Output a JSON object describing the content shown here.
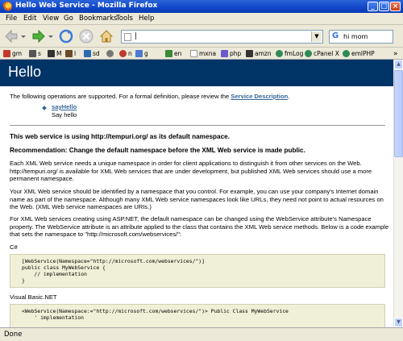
{
  "window": {
    "title": "Hello Web Service - Mozilla Firefox",
    "buttons": {
      "minimize": "_",
      "maximize": "□",
      "close": "×"
    }
  },
  "menu": [
    "File",
    "Edit",
    "View",
    "Go",
    "Bookmarks",
    "Tools",
    "Help"
  ],
  "address_bar": {
    "value": "|"
  },
  "search_bar": {
    "value": "hi mom"
  },
  "bookmarks": [
    {
      "label": "gm",
      "color": "#c0392b"
    },
    {
      "label": "s",
      "color": "#555555"
    },
    {
      "label": "M",
      "color": "#333333"
    },
    {
      "label": "l",
      "color": "#6b4a2b"
    },
    {
      "label": "sd",
      "color": "#2b6cb0"
    },
    {
      "label": "",
      "color": "#777777"
    },
    {
      "label": "n",
      "color": "#c0392b"
    },
    {
      "label": "g",
      "color": "#4a7bd0"
    },
    {
      "label": "en",
      "color": "#3a8a3a"
    },
    {
      "label": "mxna",
      "color": "#ffffff"
    },
    {
      "label": "php",
      "color": "#6a5acd"
    },
    {
      "label": "amzn",
      "color": "#333333"
    },
    {
      "label": "fmLog",
      "color": "#2e8b57"
    },
    {
      "label": "cPanel X",
      "color": "#2e8b57"
    },
    {
      "label": "emlPHP",
      "color": "#2e8b57"
    }
  ],
  "page": {
    "heading": "Hello",
    "intro": "The following operations are supported. For a formal definition, please review the",
    "service_description_link": "Service Description",
    "intro_end": ".",
    "operation_link": "sayHello",
    "operation_desc": "Say hello",
    "namespace_notice": "This web service is using http://tempuri.org/ as its default namespace.",
    "recommendation": "Recommendation: Change the default namespace before the XML Web service is made public.",
    "para1": "Each XML Web service needs a unique namespace in order for client applications to distinguish it from other services on the Web. http://tempuri.org/ is available for XML Web services that are under development, but published XML Web services should use a more permanent namespace.",
    "para2": "Your XML Web service should be identified by a namespace that you control. For example, you can use your company's Internet domain name as part of the namespace. Although many XML Web service namespaces look like URLs, they need not point to actual resources on the Web. (XML Web service namespaces are URIs.)",
    "para3": "For XML Web services creating using ASP.NET, the default namespace can be changed using the WebService attribute's Namespace property. The WebService attribute is an attribute applied to the class that contains the XML Web service methods. Below is a code example that sets the namespace to \"http://microsoft.com/webservices/\":",
    "csharp_label": "C#",
    "csharp_code": "[WebService(Namespace=\"http://microsoft.com/webservices/\")]\npublic class MyWebService {\n    // implementation\n}",
    "vb_label": "Visual Basic.NET",
    "vb_code": "<WebService(Namespace:=\"http://microsoft.com/webservices/\")> Public Class MyWebService\n    ' implementation"
  },
  "status": {
    "text": "Done"
  },
  "colors": {
    "heading_bg": "#003366",
    "link": "#336699",
    "code_bg": "#f0f0d8"
  }
}
